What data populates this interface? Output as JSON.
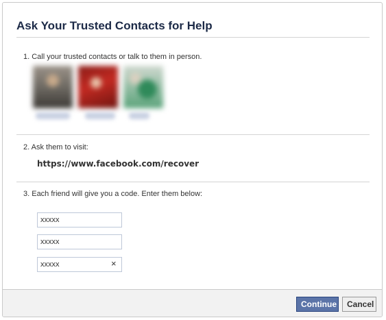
{
  "dialog": {
    "title": "Ask Your Trusted Contacts for Help"
  },
  "steps": {
    "step1": "1. Call your trusted contacts or talk to them in person.",
    "step2": "2. Ask them to visit:",
    "step3": "3. Each friend will give you a code. Enter them below:"
  },
  "recover_url": "https://www.facebook.com/recover",
  "codes": [
    {
      "value": "xxxxx"
    },
    {
      "value": "xxxxx"
    },
    {
      "value": "xxxxx"
    }
  ],
  "clear_glyph": "×",
  "footer": {
    "continue_label": "Continue",
    "cancel_label": "Cancel"
  },
  "colors": {
    "title": "#1c2a47",
    "primary_button": "#5b74a8",
    "footer_bg": "#f2f2f2"
  }
}
